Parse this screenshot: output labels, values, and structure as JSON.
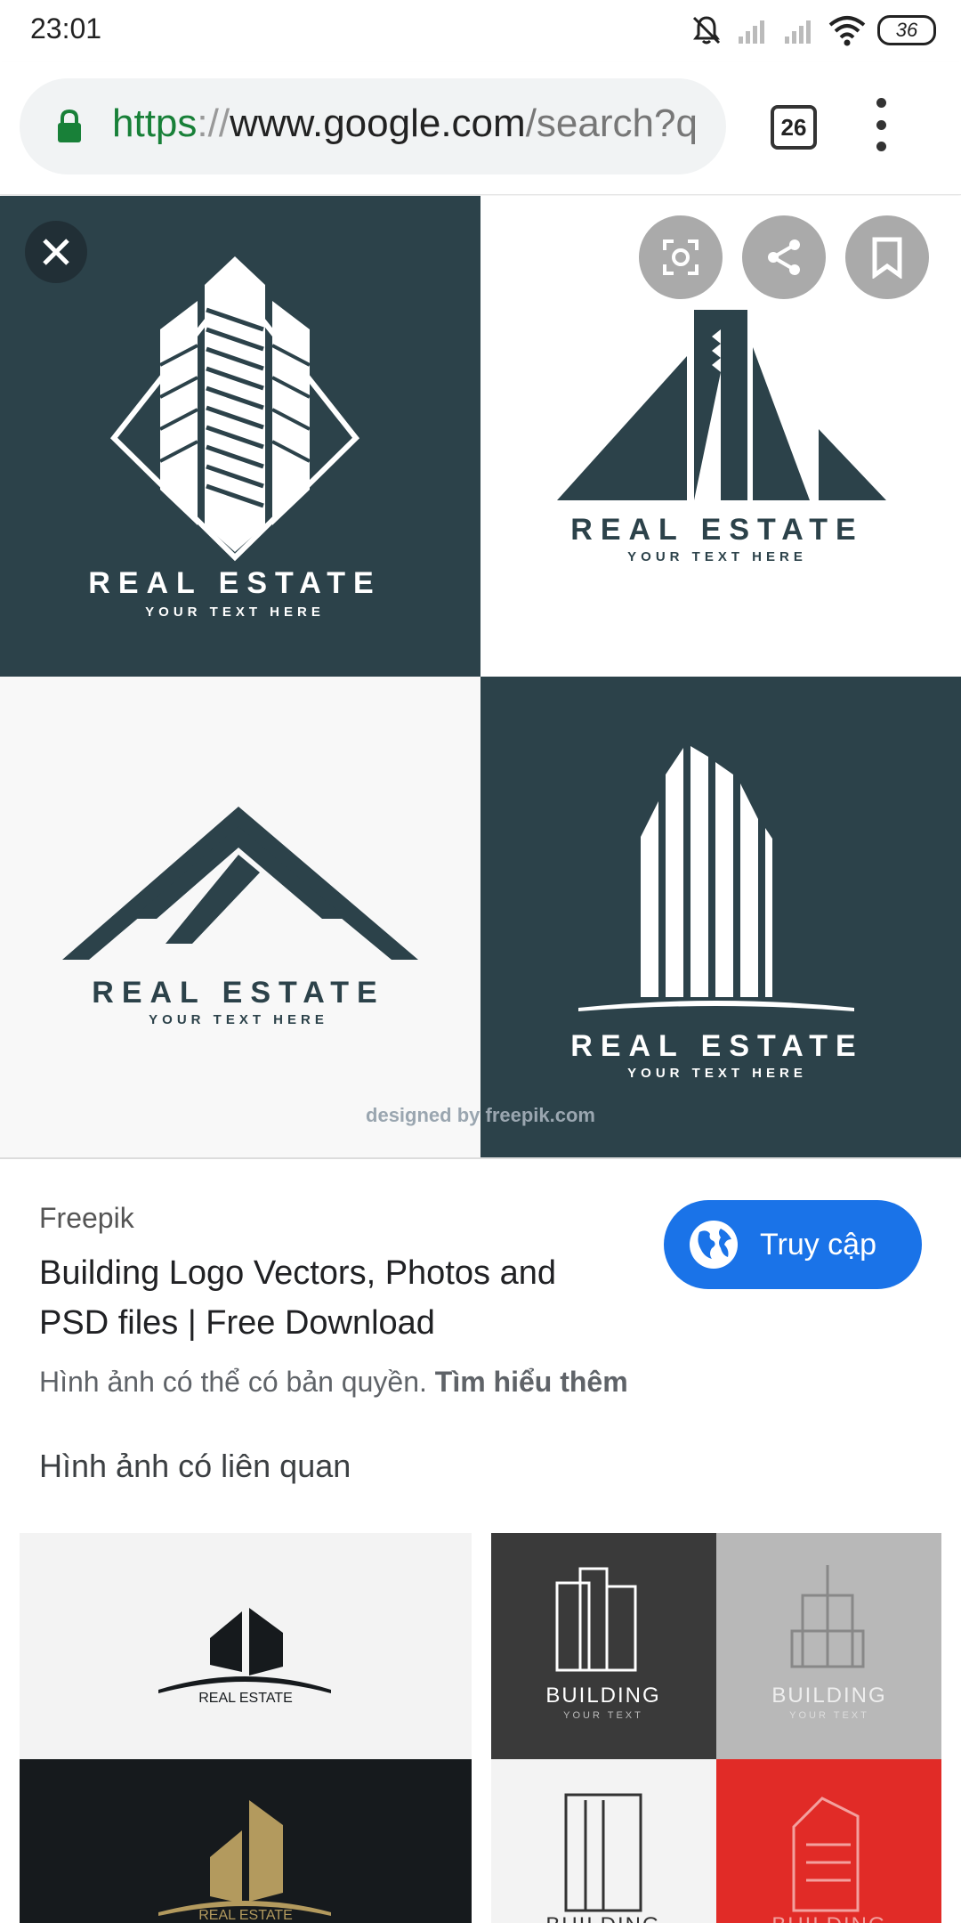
{
  "status_bar": {
    "time": "23:01",
    "battery": "36"
  },
  "browser": {
    "url_scheme": "https",
    "url_separator": "://",
    "url_host": "www.google.com",
    "url_path": "/search?q",
    "tab_count": "26"
  },
  "image": {
    "logos": [
      {
        "title": "REAL ESTATE",
        "tagline": "YOUR TEXT HERE"
      },
      {
        "title": "REAL ESTATE",
        "tagline": "YOUR TEXT HERE"
      },
      {
        "title": "REAL ESTATE",
        "tagline": "YOUR TEXT HERE"
      },
      {
        "title": "REAL ESTATE",
        "tagline": "YOUR TEXT HERE"
      }
    ],
    "watermark": "designed by freepik.com"
  },
  "result": {
    "source": "Freepik",
    "title": "Building Logo Vectors, Photos and PSD files | Free Download",
    "visit_label": "Truy cập",
    "copyright_text": "Hình ảnh có thể có bản quyền.",
    "learn_more": "Tìm hiểu thêm"
  },
  "related": {
    "heading": "Hình ảnh có liên quan",
    "thumbs": [
      {
        "top_title": "REAL ESTATE",
        "bottom_title": "REAL ESTATE"
      },
      {
        "labels": [
          "BUILDING",
          "BUILDING",
          "BUILDING",
          "BUILDING"
        ],
        "taglines": [
          "YOUR TEXT",
          "YOUR TEXT"
        ]
      }
    ]
  },
  "colors": {
    "accent": "#1a73e8",
    "logo_dark": "#2c424a",
    "secure": "#188038"
  }
}
